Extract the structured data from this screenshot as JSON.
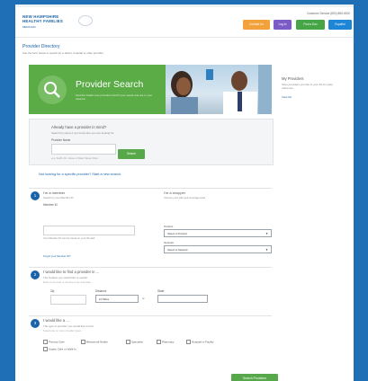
{
  "header": {
    "logo_line1": "NEW HAMPSHIRE",
    "logo_line2": "HEALTHY FAMILIES",
    "logo_line3": "MEDICAID",
    "account": "Customer Service (800) 865-0000",
    "buttons": [
      "Contact Us",
      "Log In",
      "Find a Doc",
      "Español"
    ]
  },
  "page": {
    "title": "Provider Directory",
    "subtitle": "Use the form below to search for a doctor, hospital or other provider."
  },
  "banner": {
    "title": "Provider Search",
    "subtitle": "Find the health care providers that fit your needs and are in your network."
  },
  "sidebar": {
    "heading": "My Providers",
    "text": "Save providers you like to your list for easy reference.",
    "link": "View list"
  },
  "lookup": {
    "heading": "Already have a provider in mind?",
    "desc": "Search by name if you know who you are looking for.",
    "label": "Provider Name",
    "button": "Search",
    "hint": "e.g. Smith, Dr. Jones or Main Street Clinic"
  },
  "search_link": "Not looking for a specific provider? Start a new search.",
  "step1": {
    "number": "1",
    "col1_heading": "I'm a member",
    "col1_text": "Search by your Member ID",
    "label_member_id": "Member ID",
    "note": "Your Member ID can be found on your ID card.",
    "link": "Forgot your Member ID?",
    "col2_heading": "I'm a shopper",
    "col2_text": "Choose your plan and coverage area",
    "label_product": "Product",
    "product_value": "Select A Product",
    "label_network": "Network",
    "network_value": "Select A Network"
  },
  "step2": {
    "number": "2",
    "heading": "I would like to find a provider in ...",
    "desc": "The location you would like to search.",
    "desc2": "Enter a zip code or choose a city and state.",
    "label_zip": "Zip",
    "label_distance": "Distance",
    "distance_value": "10 Miles",
    "or": "or",
    "label_state": "State",
    "state_value": ""
  },
  "step3": {
    "number": "3",
    "heading": "I would like a ...",
    "desc": "The type of provider you would like to find.",
    "desc2": "Select one or more provider types.",
    "options": [
      "Primary Care",
      "Behavioral Health",
      "Specialist",
      "Pharmacy",
      "Hospital or Facility"
    ],
    "option_row2": "Urgent Care or Walk-In"
  },
  "submit": "Search Providers",
  "colors": {
    "brand_blue": "#1b63a8",
    "green": "#57a84a",
    "orange": "#f3a13a",
    "purple": "#7b5cc7",
    "bg": "#1e6fb5"
  }
}
